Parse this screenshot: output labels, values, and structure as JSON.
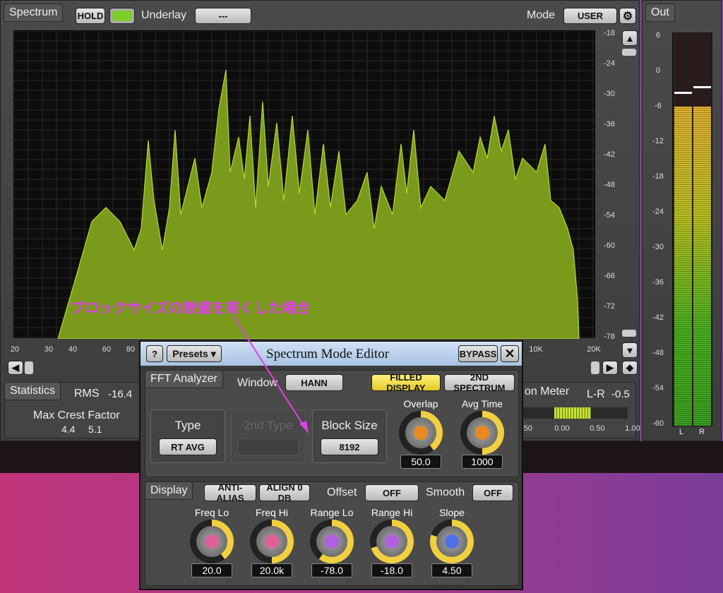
{
  "spectrum": {
    "tab": "Spectrum",
    "hold": "HOLD",
    "underlay_label": "Underlay",
    "underlay_value": "---",
    "mode_label": "Mode",
    "mode_value": "USER",
    "fill_color": "#7a9a1c",
    "db_scale": [
      "-18",
      "-24",
      "-30",
      "-36",
      "-42",
      "-48",
      "-54",
      "-60",
      "-66",
      "-72",
      "-78"
    ],
    "freq_scale": [
      "20",
      "30",
      "40",
      "60",
      "80",
      "10K",
      "20K"
    ]
  },
  "out": {
    "tab": "Out",
    "scale": [
      "6",
      "0",
      "-6",
      "-12",
      "-18",
      "-24",
      "-30",
      "-36",
      "-42",
      "-48",
      "-54",
      "-60"
    ],
    "channels": [
      "L",
      "R"
    ],
    "level_l_db": -6.5,
    "level_r_db": -6.5,
    "peak_l_db": -4,
    "peak_r_db": -3
  },
  "statistics": {
    "tab": "Statistics",
    "rms_label": "RMS",
    "rms_value": "-16.4",
    "crest_label": "Max Crest Factor",
    "crest_values": [
      "4.4",
      "5.1"
    ]
  },
  "correlation": {
    "tab": "on Meter",
    "lr_label": "L-R",
    "lr_value": "-0.5",
    "scale": [
      "-50",
      "0.00",
      "0.50",
      "1.00"
    ]
  },
  "annotation": {
    "text": "ブロックサイズの数値を高くした場合",
    "color": "#e040e8"
  },
  "editor": {
    "help": "?",
    "presets": "Presets ▾",
    "title": "Spectrum Mode Editor",
    "bypass": "BYPASS",
    "fft": {
      "tab": "FFT Analyzer",
      "window_label": "Window",
      "window_value": "HANN",
      "filled_display": "FILLED DISPLAY",
      "second_spectrum": "2ND SPECTRUM",
      "type_label": "Type",
      "type_value": "RT AVG",
      "second_type_label": "2nd Type",
      "block_label": "Block Size",
      "block_value": "8192",
      "knobs": [
        {
          "name": "Overlap",
          "value": "50.0"
        },
        {
          "name": "Avg Time",
          "value": "1000"
        }
      ]
    },
    "display": {
      "tab": "Display",
      "anti_alias": "ANTI-ALIAS",
      "align": "ALIGN 0 DB",
      "offset_label": "Offset",
      "offset_value": "OFF",
      "smooth_label": "Smooth",
      "smooth_value": "OFF",
      "knobs": [
        {
          "name": "Freq Lo",
          "value": "20.0",
          "color": "#e0609a"
        },
        {
          "name": "Freq Hi",
          "value": "20.0k",
          "color": "#e0609a"
        },
        {
          "name": "Range Lo",
          "value": "-78.0",
          "color": "#b060e0"
        },
        {
          "name": "Range Hi",
          "value": "-18.0",
          "color": "#b060e0"
        },
        {
          "name": "Slope",
          "value": "4.50",
          "color": "#5070e8"
        }
      ]
    }
  }
}
